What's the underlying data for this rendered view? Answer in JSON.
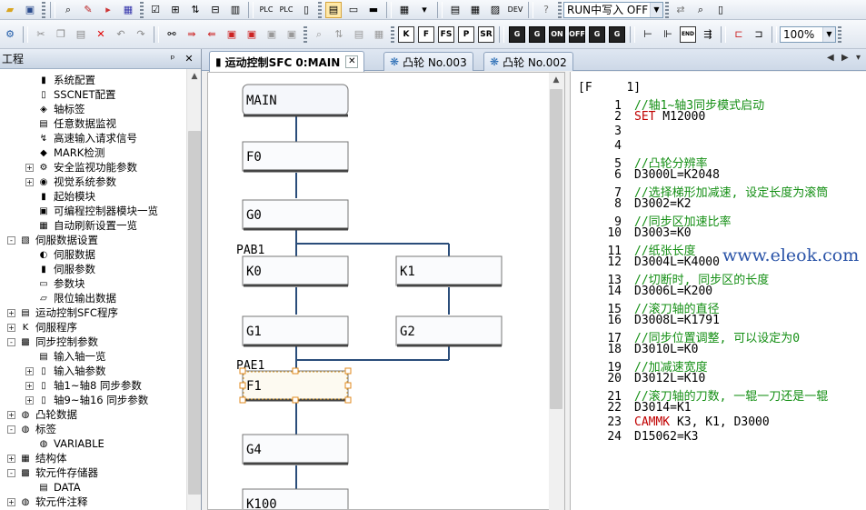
{
  "toolbar_top": {
    "run_mode_label": "RUN中写入 OFF"
  },
  "toolbar_bottom": {
    "zoom": "100%",
    "boxed_buttons": [
      "K",
      "F",
      "FS",
      "P",
      "SR"
    ],
    "dark_buttons": [
      "G",
      "G",
      "ON",
      "OFF",
      "G",
      "G"
    ]
  },
  "left_panel": {
    "title": "工程",
    "pin_glyph": "ᵖ",
    "close_glyph": "✕",
    "items": [
      {
        "label": "系统配置",
        "indent": 2,
        "expander": "",
        "icon": "▮"
      },
      {
        "label": "SSCNET配置",
        "indent": 2,
        "expander": "",
        "icon": "▯"
      },
      {
        "label": "轴标签",
        "indent": 2,
        "expander": "",
        "icon": "◈"
      },
      {
        "label": "任意数据监视",
        "indent": 2,
        "expander": "",
        "icon": "▤"
      },
      {
        "label": "高速输入请求信号",
        "indent": 2,
        "expander": "",
        "icon": "↯"
      },
      {
        "label": "MARK检测",
        "indent": 2,
        "expander": "",
        "icon": "◆"
      },
      {
        "label": "安全监视功能参数",
        "indent": 2,
        "expander": "+",
        "icon": "⚙"
      },
      {
        "label": "视觉系统参数",
        "indent": 2,
        "expander": "+",
        "icon": "◉"
      },
      {
        "label": "起始模块",
        "indent": 2,
        "expander": "",
        "icon": "▮"
      },
      {
        "label": "可编程控制器模块一览",
        "indent": 2,
        "expander": "",
        "icon": "▣"
      },
      {
        "label": "自动刷新设置一览",
        "indent": 2,
        "expander": "",
        "icon": "▦"
      },
      {
        "label": "伺服数据设置",
        "indent": 1,
        "expander": "-",
        "icon": "▧"
      },
      {
        "label": "伺服数据",
        "indent": 2,
        "expander": "",
        "icon": "◐"
      },
      {
        "label": "伺服参数",
        "indent": 2,
        "expander": "",
        "icon": "▮"
      },
      {
        "label": "参数块",
        "indent": 2,
        "expander": "",
        "icon": "▭"
      },
      {
        "label": "限位输出数据",
        "indent": 2,
        "expander": "",
        "icon": "▱"
      },
      {
        "label": "运动控制SFC程序",
        "indent": 1,
        "expander": "+",
        "icon": "▤"
      },
      {
        "label": "伺服程序",
        "indent": 1,
        "expander": "+",
        "icon": "K"
      },
      {
        "label": "同步控制参数",
        "indent": 1,
        "expander": "-",
        "icon": "▩"
      },
      {
        "label": "输入轴一览",
        "indent": 2,
        "expander": "",
        "icon": "▤"
      },
      {
        "label": "输入轴参数",
        "indent": 2,
        "expander": "+",
        "icon": "▯"
      },
      {
        "label": "轴1~轴8 同步参数",
        "indent": 2,
        "expander": "+",
        "icon": "▯"
      },
      {
        "label": "轴9~轴16 同步参数",
        "indent": 2,
        "expander": "+",
        "icon": "▯"
      },
      {
        "label": "凸轮数据",
        "indent": 1,
        "expander": "+",
        "icon": "◍"
      },
      {
        "label": "标签",
        "indent": 1,
        "expander": "-",
        "icon": "◍"
      },
      {
        "label": "VARIABLE",
        "indent": 2,
        "expander": "",
        "icon": "◍"
      },
      {
        "label": "结构体",
        "indent": 1,
        "expander": "+",
        "icon": "▦"
      },
      {
        "label": "软元件存储器",
        "indent": 1,
        "expander": "-",
        "icon": "▩"
      },
      {
        "label": "DATA",
        "indent": 2,
        "expander": "",
        "icon": "▤"
      },
      {
        "label": "软元件注释",
        "indent": 1,
        "expander": "+",
        "icon": "◍"
      }
    ]
  },
  "tabs": [
    {
      "label": "运动控制SFC 0:MAIN",
      "active": true
    },
    {
      "label": "凸轮 No.003",
      "active": false
    },
    {
      "label": "凸轮 No.002",
      "active": false
    }
  ],
  "sfc": {
    "start": "MAIN",
    "pab1_label": "PAB1",
    "pae1_label": "PAE1",
    "steps": [
      "F0",
      "G0",
      "K0",
      "K1",
      "G1",
      "G2",
      "F1",
      "G4",
      "K100"
    ]
  },
  "ladder": {
    "header_left": "[F",
    "header_num": "1]",
    "lines": [
      {
        "n": "1",
        "text": "//轴1~轴3同步模式启动",
        "kind": "comment"
      },
      {
        "n": "2",
        "kw": "SET",
        "text": " M12000",
        "kind": "keyword"
      },
      {
        "n": "3",
        "text": "",
        "kind": "plain"
      },
      {
        "n": "4",
        "text": "",
        "kind": "plain"
      },
      {
        "n": "5",
        "text": "//凸轮分辨率",
        "kind": "comment"
      },
      {
        "n": "6",
        "text": "D3000L=K2048",
        "kind": "plain"
      },
      {
        "n": "7",
        "text": "//选择梯形加减速, 设定长度为滚筒",
        "kind": "comment"
      },
      {
        "n": "8",
        "text": "D3002=K2",
        "kind": "plain"
      },
      {
        "n": "9",
        "text": "//同步区加速比率",
        "kind": "comment"
      },
      {
        "n": "10",
        "text": "D3003=K0",
        "kind": "plain"
      },
      {
        "n": "11",
        "text": "//纸张长度",
        "kind": "comment"
      },
      {
        "n": "12",
        "text": "D3004L=K4000",
        "kind": "plain"
      },
      {
        "n": "13",
        "text": "//切断时, 同步区的长度",
        "kind": "comment"
      },
      {
        "n": "14",
        "text": "D3006L=K200",
        "kind": "plain"
      },
      {
        "n": "15",
        "text": "//滚刀轴的直径",
        "kind": "comment"
      },
      {
        "n": "16",
        "text": "D3008L=K1791",
        "kind": "plain"
      },
      {
        "n": "17",
        "text": "//同步位置调整, 可以设定为0",
        "kind": "comment"
      },
      {
        "n": "18",
        "text": "D3010L=K0",
        "kind": "plain"
      },
      {
        "n": "19",
        "text": "//加减速宽度",
        "kind": "comment"
      },
      {
        "n": "20",
        "text": "D3012L=K10",
        "kind": "plain"
      },
      {
        "n": "21",
        "text": "//滚刀轴的刀数, 一辊一刀还是一辊",
        "kind": "comment"
      },
      {
        "n": "22",
        "text": "D3014=K1",
        "kind": "plain"
      },
      {
        "n": "23",
        "kw": "CAMMK",
        "text": " K3, K1, D3000",
        "kind": "keyword"
      },
      {
        "n": "24",
        "text": "D15062=K3",
        "kind": "plain"
      }
    ]
  },
  "watermark": "www.eleok.com"
}
